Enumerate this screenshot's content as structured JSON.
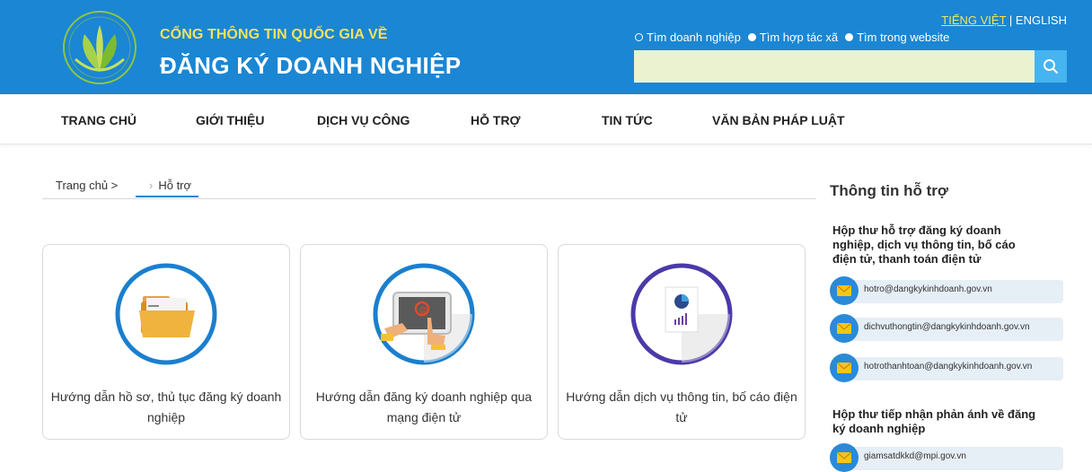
{
  "header": {
    "title_small": "CỔNG THÔNG TIN QUỐC GIA VỀ",
    "title_big": "ĐĂNG KÝ DOANH NGHIỆP",
    "lang_vi": "TIẾNG VIỆT",
    "lang_sep": "|",
    "lang_en": "ENGLISH",
    "radios": [
      "Tìm doanh nghiệp",
      "Tìm hợp tác xã",
      "Tìm trong website"
    ],
    "search_value": ""
  },
  "nav": [
    "TRANG CHỦ",
    "GIỚI THIỆU",
    "DỊCH VỤ CÔNG",
    "HỖ TRỢ",
    "TIN TỨC",
    "VĂN BẢN PHÁP LUẬT"
  ],
  "breadcrumb": {
    "home": "Trang chủ >",
    "sep": "›",
    "current": "Hỗ trợ"
  },
  "cards": [
    "Hướng dẫn hồ sơ, thủ tục đăng ký doanh nghiệp",
    "Hướng dẫn đăng ký doanh nghiệp qua mạng điện tử",
    "Hướng dẫn dịch vụ thông tin, bố cáo điện tử"
  ],
  "sidebar": {
    "title": "Thông tin hỗ trợ",
    "heading1": "Hộp thư hỗ trợ đăng ký doanh nghiệp, dịch vụ thông tin, bố cáo điện tử, thanh toán điện tử",
    "emails1": [
      "hotro@dangkykinhdoanh.gov.vn",
      "dichvuthongtin@dangkykinhdoanh.gov.vn",
      "hotrothanhtoan@dangkykinhdoanh.gov.vn"
    ],
    "heading2": "Hộp thư tiếp nhận phản ánh về đăng ký doanh nghiệp",
    "emails2": [
      "giamsatdkkd@mpi.gov.vn"
    ]
  }
}
